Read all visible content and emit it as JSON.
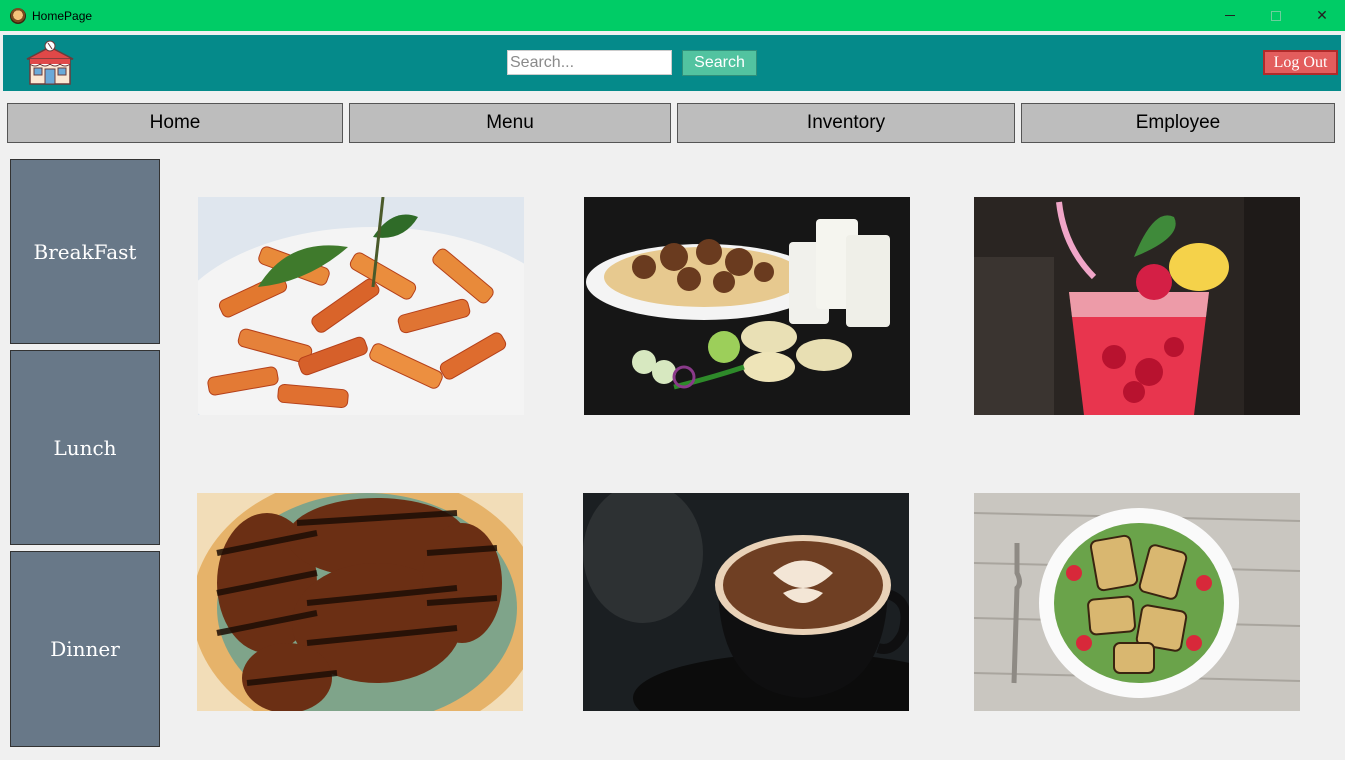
{
  "window": {
    "title": "HomePage"
  },
  "header": {
    "search_placeholder": "Search...",
    "search_label": "Search",
    "logout_label": "Log Out"
  },
  "nav": {
    "home": "Home",
    "menu": "Menu",
    "inventory": "Inventory",
    "employee": "Employee"
  },
  "sidebar": {
    "items": [
      {
        "label": "BreakFast"
      },
      {
        "label": "Lunch"
      },
      {
        "label": "Dinner"
      }
    ]
  },
  "gallery": {
    "items": [
      {
        "icon": "pasta-image"
      },
      {
        "icon": "biryani-image"
      },
      {
        "icon": "drink-image"
      },
      {
        "icon": "grilled-chicken-image"
      },
      {
        "icon": "coffee-image"
      },
      {
        "icon": "salad-image"
      }
    ]
  },
  "colors": {
    "titlebar": "#00cc66",
    "header": "#058a8a",
    "search_button": "#52c3a0",
    "logout_button": "#e35d5d",
    "nav_button": "#bdbdbd",
    "sidebar_button": "#687888"
  }
}
